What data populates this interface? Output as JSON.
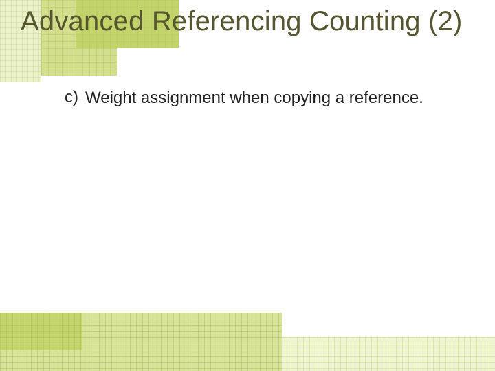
{
  "title": "Advanced Referencing Counting (2)",
  "list": {
    "marker": "c)",
    "text": "Weight assignment when copying a reference."
  },
  "grid": {
    "light": "#e7eec2",
    "mid": "#d3df8f",
    "dark": "#b9cc4e",
    "line": "#9fb23a"
  }
}
